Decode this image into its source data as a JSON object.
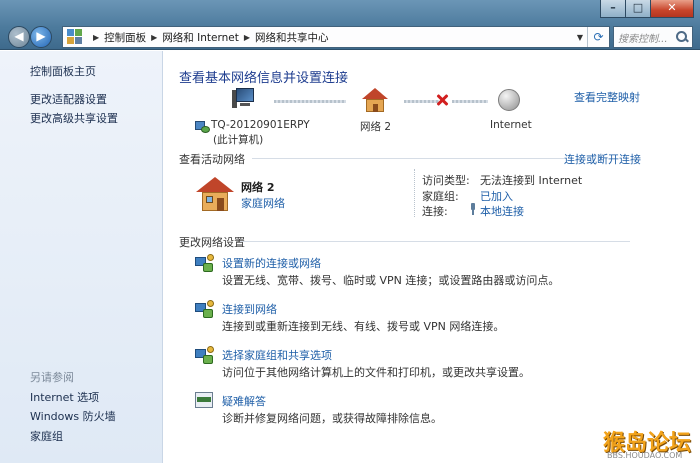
{
  "window": {
    "controls": {
      "minimize": "–",
      "maximize": "□",
      "close": "✕"
    }
  },
  "nav": {
    "back_icon": "back-arrow-icon",
    "forward_icon": "forward-arrow-icon"
  },
  "address": {
    "crumbs": [
      "控制面板",
      "网络和 Internet",
      "网络和共享中心"
    ],
    "refresh_icon": "refresh-icon"
  },
  "search": {
    "placeholder": "搜索控制..."
  },
  "sidebar": {
    "home": "控制面板主页",
    "items": [
      "更改适配器设置",
      "更改高级共享设置"
    ],
    "see_also_title": "另请参阅",
    "see_also": [
      "Internet 选项",
      "Windows 防火墙",
      "家庭组"
    ]
  },
  "main": {
    "title": "查看基本网络信息并设置连接",
    "view_full_map": "查看完整映射",
    "map": {
      "computer_name": "TQ-20120901ERPY",
      "computer_note": "(此计算机)",
      "network": "网络  2",
      "internet": "Internet"
    },
    "active_title": "查看活动网络",
    "connect_disconnect": "连接或断开连接",
    "active": {
      "name": "网络  2",
      "type": "家庭网络",
      "access_label": "访问类型:",
      "access_value": "无法连接到 Internet",
      "homegroup_label": "家庭组:",
      "homegroup_value": "已加入",
      "connections_label": "连接:",
      "connections_value": "本地连接"
    },
    "change_title": "更改网络设置",
    "tasks": [
      {
        "title": "设置新的连接或网络",
        "desc": "设置无线、宽带、拨号、临时或 VPN 连接；或设置路由器或访问点。"
      },
      {
        "title": "连接到网络",
        "desc": "连接到或重新连接到无线、有线、拨号或 VPN 网络连接。"
      },
      {
        "title": "选择家庭组和共享选项",
        "desc": "访问位于其他网络计算机上的文件和打印机，或更改共享设置。"
      },
      {
        "title": "疑难解答",
        "desc": "诊断并修复网络问题，或获得故障排除信息。"
      }
    ]
  },
  "watermark": {
    "text": "猴岛论坛",
    "sub": "BBS.HOUDAO.COM"
  },
  "help_icon": "?"
}
